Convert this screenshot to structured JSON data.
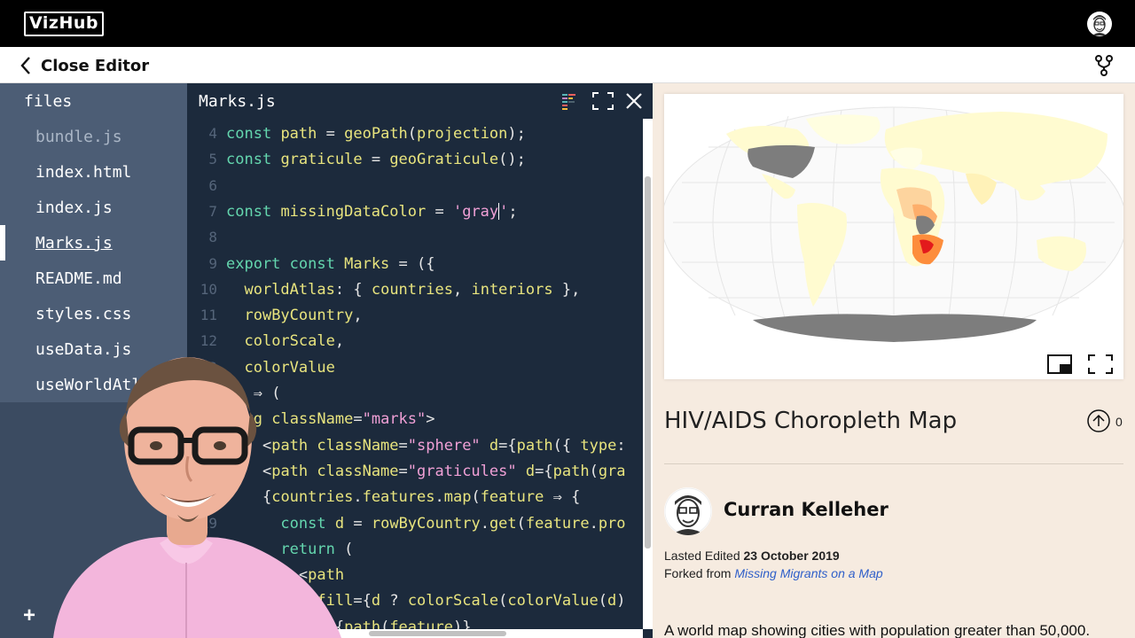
{
  "app": {
    "logo_text": "VizHub"
  },
  "editor_header": {
    "close_label": "Close Editor"
  },
  "sidebar": {
    "title": "files",
    "files": [
      {
        "name": "bundle.js"
      },
      {
        "name": "index.html"
      },
      {
        "name": "index.js"
      },
      {
        "name": "Marks.js"
      },
      {
        "name": "README.md"
      },
      {
        "name": "styles.css"
      },
      {
        "name": "useData.js"
      },
      {
        "name": "useWorldAtlas.js"
      }
    ],
    "add_label": "+"
  },
  "code": {
    "tab_name": "Marks.js",
    "lines": [
      {
        "n": "4",
        "text": "const path = geoPath(projection);"
      },
      {
        "n": "5",
        "text": "const graticule = geoGraticule();"
      },
      {
        "n": "6",
        "text": ""
      },
      {
        "n": "7",
        "text": "const missingDataColor = 'gray';"
      },
      {
        "n": "8",
        "text": ""
      },
      {
        "n": "9",
        "text": "export const Marks = ({"
      },
      {
        "n": "10",
        "text": "  worldAtlas: { countries, interiors },"
      },
      {
        "n": "11",
        "text": "  rowByCountry,"
      },
      {
        "n": "12",
        "text": "  colorScale,"
      },
      {
        "n": "13",
        "text": "  colorValue"
      },
      {
        "n": "14",
        "text": "}) => ("
      },
      {
        "n": "15",
        "text": "  <g className=\"marks\">"
      },
      {
        "n": "16",
        "text": "    <path className=\"sphere\" d={path({ type:"
      },
      {
        "n": "17",
        "text": "    <path className=\"graticules\" d={path(gra"
      },
      {
        "n": "18",
        "text": "    {countries.features.map(feature => {"
      },
      {
        "n": "19",
        "text": "      const d = rowByCountry.get(feature.pro"
      },
      {
        "n": "20",
        "text": "      return ("
      },
      {
        "n": "21",
        "text": "        <path"
      },
      {
        "n": "22",
        "text": "          fill={d ? colorScale(colorValue(d)"
      },
      {
        "n": "23",
        "text": "          d={path(feature)}"
      }
    ]
  },
  "viz": {
    "title": "HIV/AIDS Choropleth Map",
    "upvotes": "0",
    "author": "Curran Kelleher",
    "last_edited_label": "Lasted Edited",
    "last_edited_date": "23 October 2019",
    "forked_from_label": "Forked from",
    "forked_from_link": "Missing Migrants on a Map",
    "description": "A world map showing cities with population greater than 50,000."
  },
  "colors": {
    "topbar": "#000000",
    "sidebar": "#4c5d75",
    "code_bg": "#1c2a3c",
    "keyword": "#64d6ae",
    "identifier": "#e8e47e",
    "string": "#f0a0d6",
    "right_panel_bg": "#f6ebe0",
    "missing_data": "#808080",
    "choropleth_high": "#e31a1c",
    "choropleth_low": "#ffffcc"
  }
}
